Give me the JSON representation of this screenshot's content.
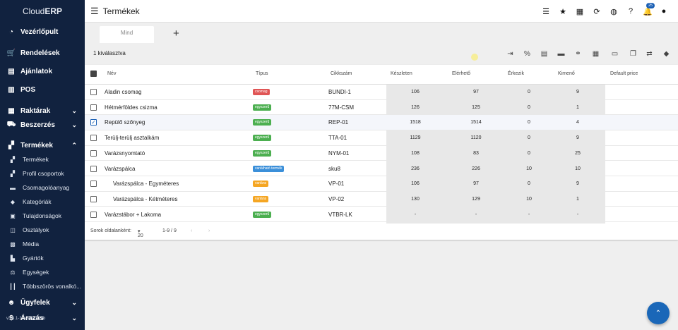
{
  "app": {
    "brand_prefix": "Cloud",
    "brand_suffix": "ERP",
    "page_title": "Termékek",
    "version": "v3.6.1-12-e96a1f29b"
  },
  "notification_count": "25",
  "sidebar": {
    "items": [
      {
        "label": "Vezérlőpult",
        "icon": "dashboard-icon",
        "glyph": "◔",
        "kind": "main",
        "chev": ""
      },
      {
        "label": "Rendelések",
        "icon": "cart-icon",
        "glyph": "🛒",
        "kind": "main",
        "chev": ""
      },
      {
        "label": "Ajánlatok",
        "icon": "document-icon",
        "glyph": "▤",
        "kind": "main",
        "chev": ""
      },
      {
        "label": "POS",
        "icon": "pos-icon",
        "glyph": "▥",
        "kind": "main",
        "chev": ""
      },
      {
        "label": "Raktárak",
        "icon": "warehouse-icon",
        "glyph": "▦",
        "kind": "main",
        "chev": "⌄"
      },
      {
        "label": "Beszerzés",
        "icon": "truck-icon",
        "glyph": "⛟",
        "kind": "main",
        "chev": "⌄"
      },
      {
        "label": "Termékek",
        "icon": "products-icon",
        "glyph": "▞",
        "kind": "main",
        "chev": "⌃"
      },
      {
        "label": "Termékek",
        "icon": "products-sub-icon",
        "glyph": "▞",
        "kind": "sub",
        "chev": ""
      },
      {
        "label": "Profil csoportok",
        "icon": "profile-groups-icon",
        "glyph": "▞",
        "kind": "sub",
        "chev": ""
      },
      {
        "label": "Csomagolóanyag",
        "icon": "package-icon",
        "glyph": "▬",
        "kind": "sub",
        "chev": ""
      },
      {
        "label": "Kategóriák",
        "icon": "tag-icon",
        "glyph": "◆",
        "kind": "sub",
        "chev": ""
      },
      {
        "label": "Tulajdonságok",
        "icon": "properties-icon",
        "glyph": "▣",
        "kind": "sub",
        "chev": ""
      },
      {
        "label": "Osztályok",
        "icon": "classes-icon",
        "glyph": "◫",
        "kind": "sub",
        "chev": ""
      },
      {
        "label": "Média",
        "icon": "media-icon",
        "glyph": "▩",
        "kind": "sub",
        "chev": ""
      },
      {
        "label": "Gyártók",
        "icon": "factory-icon",
        "glyph": "▙",
        "kind": "sub",
        "chev": ""
      },
      {
        "label": "Egységek",
        "icon": "units-icon",
        "glyph": "⚖",
        "kind": "sub",
        "chev": ""
      },
      {
        "label": "Többszörös vonalkó...",
        "icon": "barcode-icon",
        "glyph": "┃┃",
        "kind": "sub",
        "chev": ""
      },
      {
        "label": "Ügyfelek",
        "icon": "customers-icon",
        "glyph": "☻",
        "kind": "main",
        "chev": "⌄"
      },
      {
        "label": "Árazás",
        "icon": "pricing-icon",
        "glyph": "$",
        "kind": "main",
        "chev": "⌄"
      }
    ]
  },
  "tabs": {
    "mind": "Mind",
    "add": "+"
  },
  "toolbar": {
    "selected": "1 kiválasztva"
  },
  "table": {
    "headers": {
      "name": "Név",
      "type": "Típus",
      "sku": "Cikkszám",
      "stock": "Készleten",
      "available": "Elérhető",
      "incoming": "Érkezik",
      "outgoing": "Kimenő",
      "price": "Default price"
    },
    "rows": [
      {
        "name": "Aladin csomag",
        "type": "csomag",
        "sku": "BUNDI-1",
        "stock": "106",
        "available": "97",
        "incoming": "0",
        "outgoing": "9",
        "checked": false
      },
      {
        "name": "Hétmérföldes csizma",
        "type": "egyszerű",
        "sku": "77M-CSM",
        "stock": "126",
        "available": "125",
        "incoming": "0",
        "outgoing": "1",
        "checked": false
      },
      {
        "name": "Repülő szőnyeg",
        "type": "egyszerű",
        "sku": "REP-01",
        "stock": "1518",
        "available": "1514",
        "incoming": "0",
        "outgoing": "4",
        "checked": true
      },
      {
        "name": "Terülj-terülj asztalkám",
        "type": "egyszerű",
        "sku": "TTA-01",
        "stock": "1129",
        "available": "1120",
        "incoming": "0",
        "outgoing": "9",
        "checked": false
      },
      {
        "name": "Varázsnyomtató",
        "type": "egyszerű",
        "sku": "NYM-01",
        "stock": "108",
        "available": "83",
        "incoming": "0",
        "outgoing": "25",
        "checked": false
      },
      {
        "name": "Varázspálca",
        "type": "variálható termék",
        "sku": "sku8",
        "stock": "236",
        "available": "226",
        "incoming": "10",
        "outgoing": "10",
        "checked": false
      },
      {
        "name": "Varázspálca - Egyméteres",
        "type": "variáns",
        "sku": "VP-01",
        "stock": "106",
        "available": "97",
        "incoming": "0",
        "outgoing": "9",
        "checked": false,
        "indent": true
      },
      {
        "name": "Varázspálca - Kétméteres",
        "type": "variáns",
        "sku": "VP-02",
        "stock": "130",
        "available": "129",
        "incoming": "10",
        "outgoing": "1",
        "checked": false,
        "indent": true
      },
      {
        "name": "Varázstábor + Lakoma",
        "type": "egyszerű",
        "sku": "VTBR-LK",
        "stock": "-",
        "available": "-",
        "incoming": "-",
        "outgoing": "-",
        "checked": false
      }
    ],
    "type_colors": {
      "csomag": "#e05555",
      "egyszerű": "#4caf50",
      "variálható termék": "#3b8fd9",
      "variáns": "#f5a623"
    }
  },
  "footer": {
    "rows_per_page_label": "Sorok oldalanként:",
    "rows_per_page": "20",
    "range": "1-9 / 9"
  }
}
